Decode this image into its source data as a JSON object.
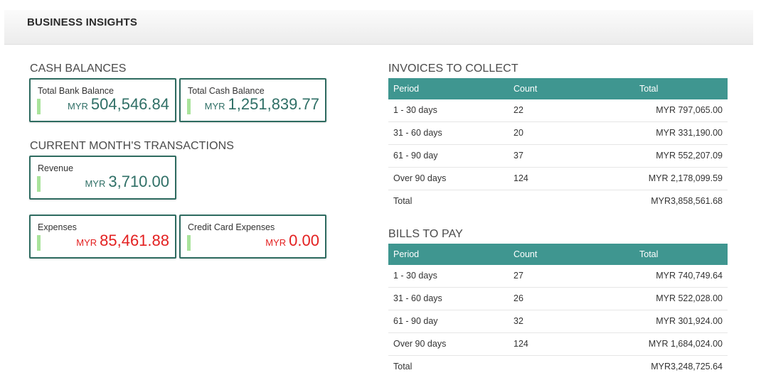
{
  "header": {
    "title": "BUSINESS INSIGHTS"
  },
  "cash_balances": {
    "title": "CASH BALANCES",
    "cards": [
      {
        "label": "Total Bank Balance",
        "currency": "MYR",
        "amount": "504,546.84"
      },
      {
        "label": "Total Cash Balance",
        "currency": "MYR",
        "amount": "1,251,839.77"
      }
    ]
  },
  "transactions": {
    "title": "CURRENT MONTH'S TRANSACTIONS",
    "revenue": {
      "label": "Revenue",
      "currency": "MYR",
      "amount": "3,710.00"
    },
    "expenses": {
      "label": "Expenses",
      "currency": "MYR",
      "amount": "85,461.88"
    },
    "credit_card": {
      "label": "Credit Card Expenses",
      "currency": "MYR",
      "amount": "0.00"
    }
  },
  "invoices": {
    "title": "INVOICES TO COLLECT",
    "columns": [
      "Period",
      "Count",
      "Total"
    ],
    "rows": [
      [
        "1 - 30 days",
        "22",
        "MYR 797,065.00"
      ],
      [
        "31 - 60 days",
        "20",
        "MYR 331,190.00"
      ],
      [
        "61 - 90 day",
        "37",
        "MYR 552,207.09"
      ],
      [
        "Over 90 days",
        "124",
        "MYR 2,178,099.59"
      ],
      [
        "Total",
        "",
        "MYR3,858,561.68"
      ]
    ]
  },
  "bills": {
    "title": "BILLS TO PAY",
    "columns": [
      "Period",
      "Count",
      "Total"
    ],
    "rows": [
      [
        "1 - 30 days",
        "27",
        "MYR 740,749.64"
      ],
      [
        "31 - 60 days",
        "26",
        "MYR 522,028.00"
      ],
      [
        "61 - 90 day",
        "32",
        "MYR 301,924.00"
      ],
      [
        "Over 90 days",
        "124",
        "MYR 1,684,024.00"
      ],
      [
        "Total",
        "",
        "MYR3,248,725.64"
      ]
    ]
  },
  "colors": {
    "card_border": "#2e6b60",
    "value_green": "#2f6f66",
    "value_red": "#e32020",
    "table_header": "#3f9690",
    "indicator_bar": "#a9e39b"
  }
}
